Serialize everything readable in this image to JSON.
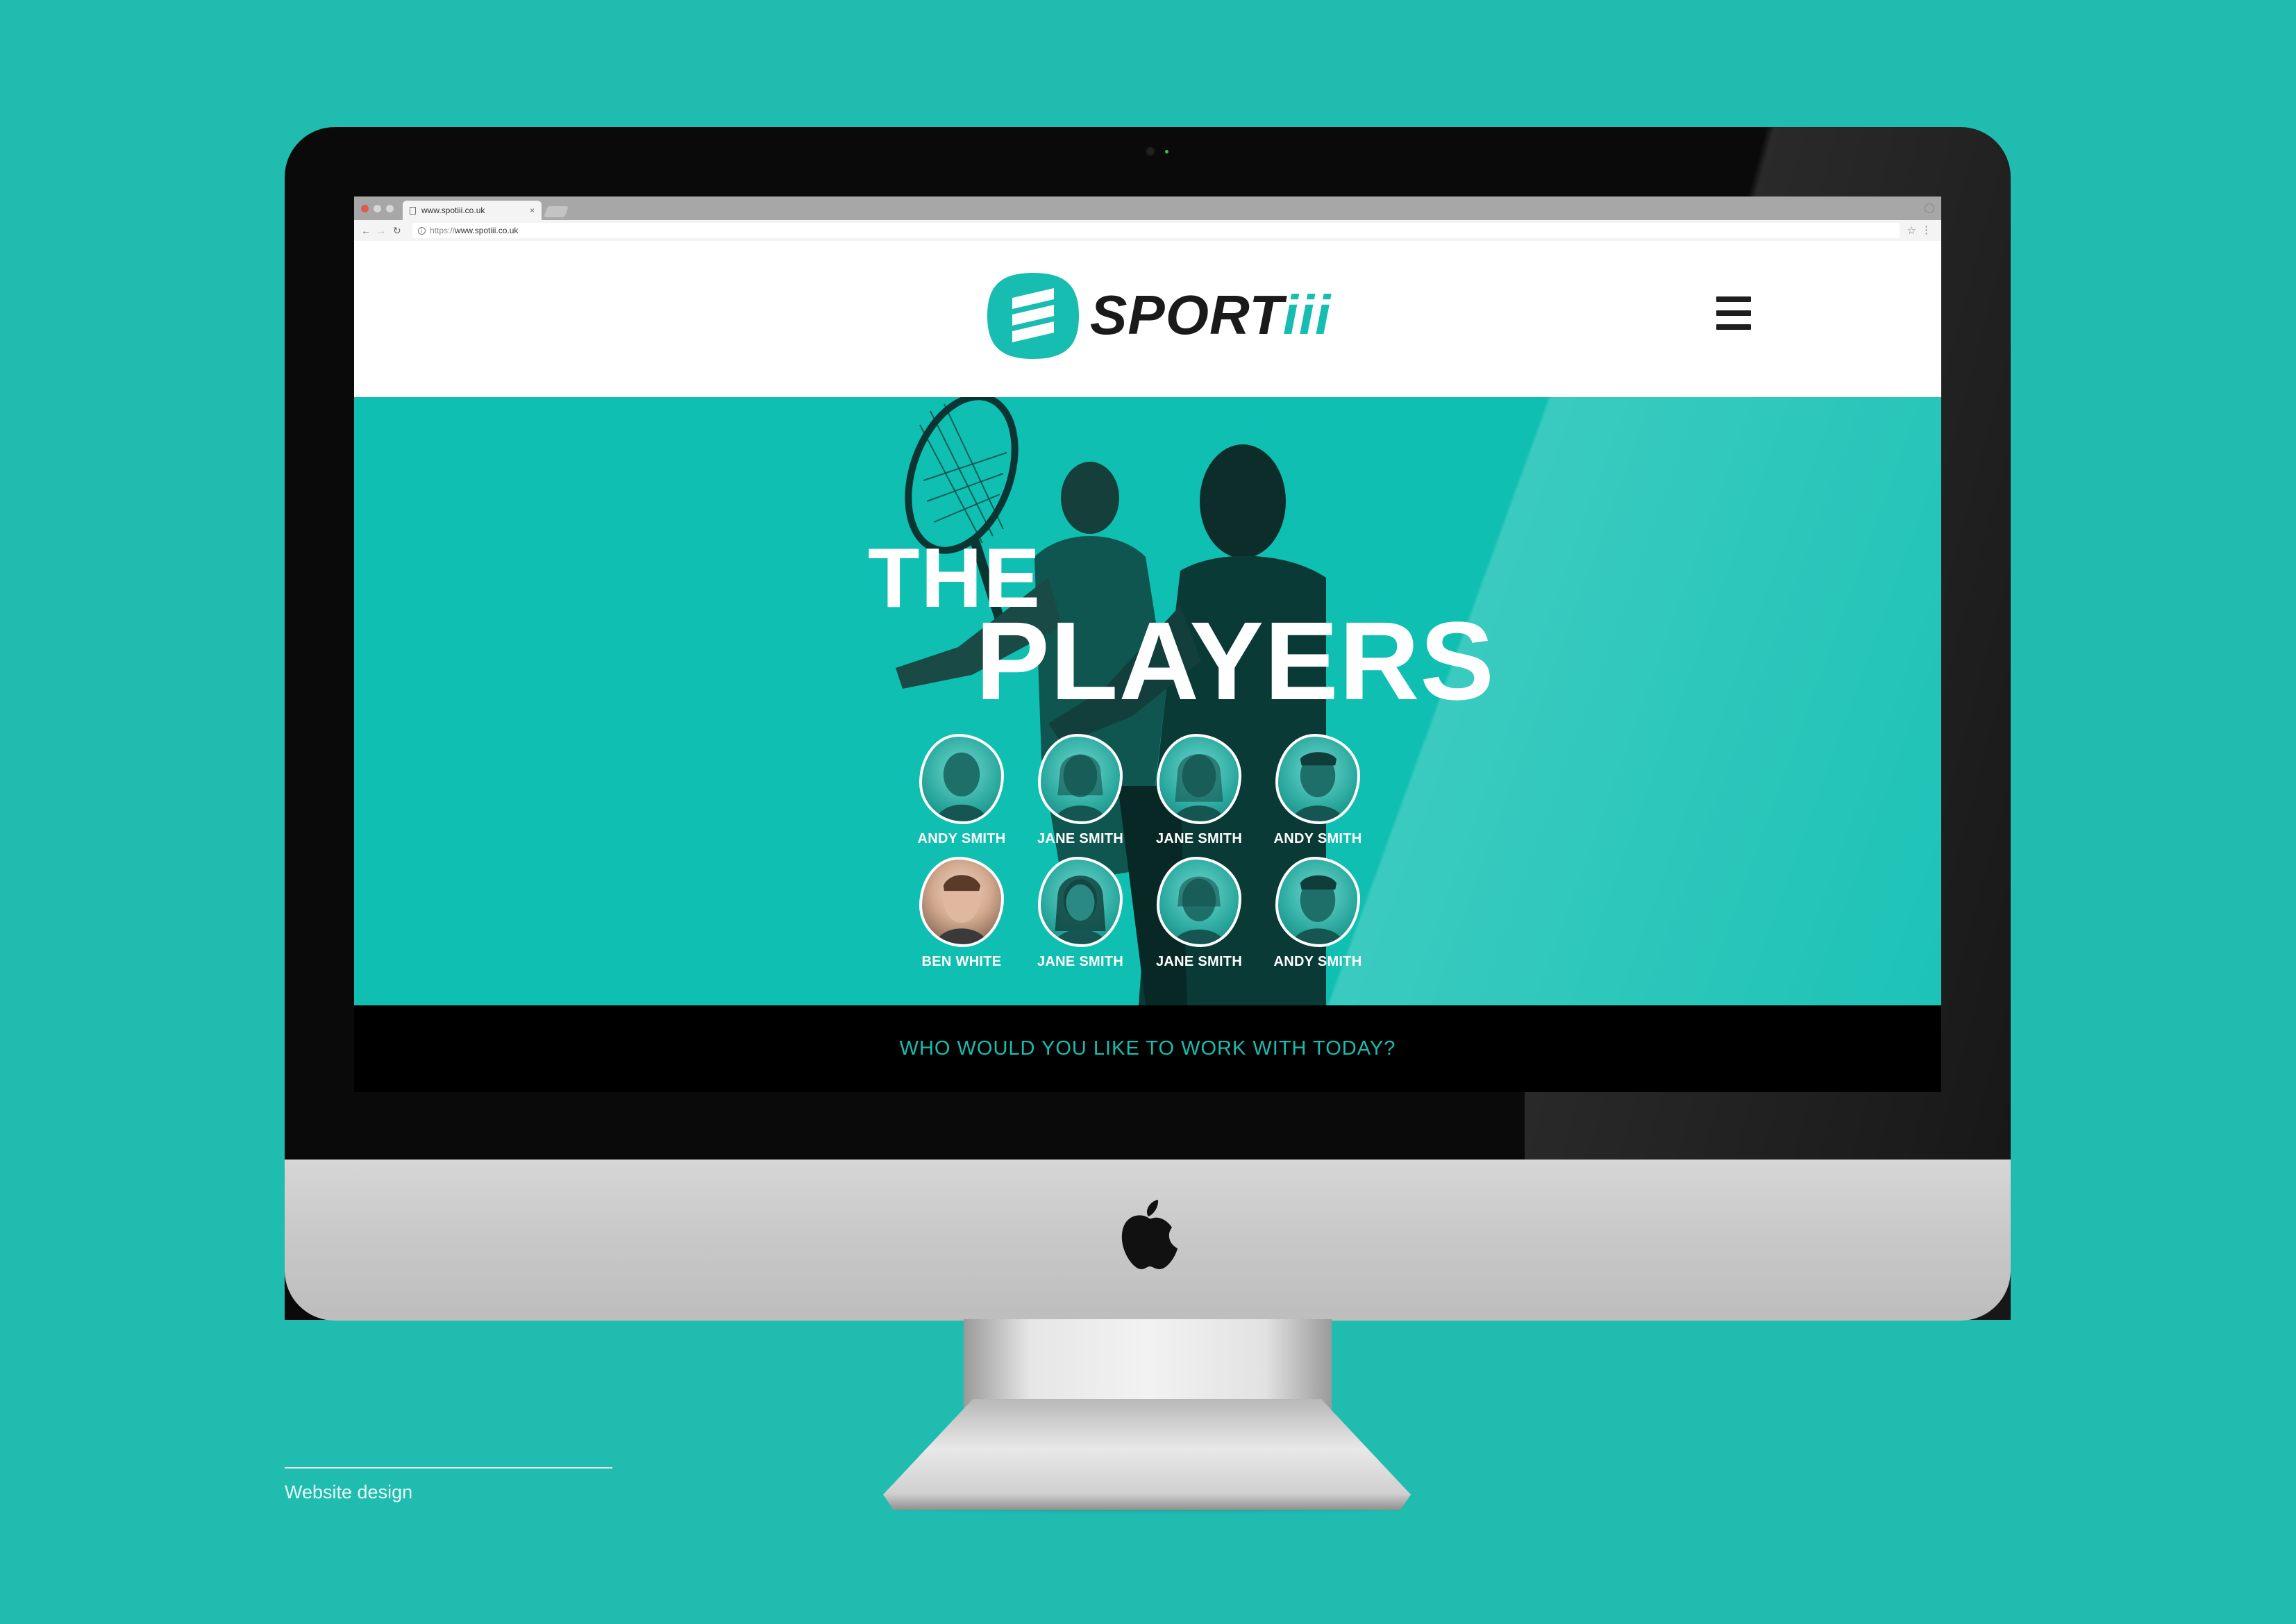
{
  "browser": {
    "tab_title": "www.spotiii.co.uk",
    "url_prefix": "https://",
    "url_host": "www.spotiii.co.uk"
  },
  "site": {
    "logo_word_main": "SPORT",
    "logo_word_accent": "iii",
    "brand_color": "#18bdb1"
  },
  "hero": {
    "title_small": "THE",
    "title_large": "PLAYERS",
    "players": [
      {
        "name": "ANDY SMITH"
      },
      {
        "name": "JANE SMITH"
      },
      {
        "name": "JANE SMITH"
      },
      {
        "name": "ANDY SMITH"
      },
      {
        "name": "BEN WHITE"
      },
      {
        "name": "JANE SMITH"
      },
      {
        "name": "JANE SMITH"
      },
      {
        "name": "ANDY SMITH"
      }
    ]
  },
  "cta": {
    "text": "WHO WOULD YOU LIKE TO WORK WITH TODAY?"
  },
  "caption": {
    "text": "Website design"
  },
  "colors": {
    "background": "#20bcb0",
    "hero": "#0fbfb2",
    "cta_bar": "#000000"
  },
  "icons": [
    "page-icon",
    "tab-close-icon",
    "back-arrow-icon",
    "forward-arrow-icon",
    "reload-icon",
    "info-icon",
    "star-icon",
    "menu-dots-icon",
    "logo-mark-icon",
    "hamburger-icon",
    "apple-logo-icon",
    "camera-icon"
  ]
}
